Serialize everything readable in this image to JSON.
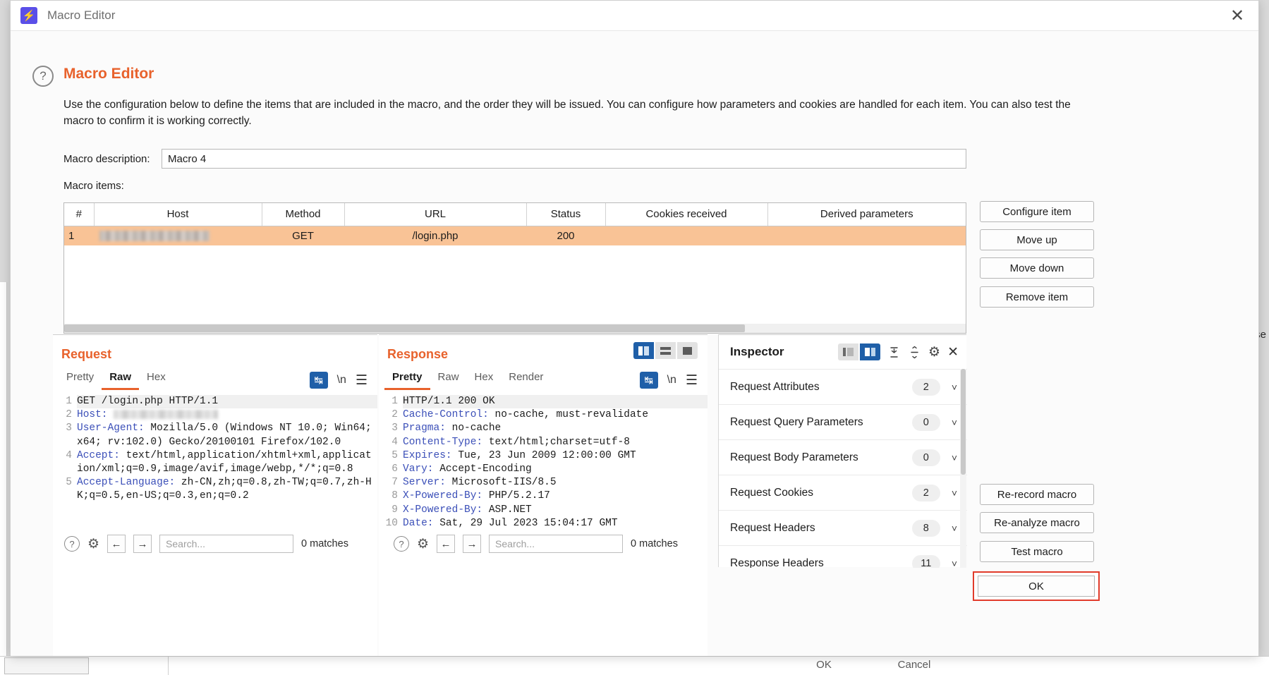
{
  "window": {
    "title": "Macro Editor",
    "app_icon": "lightning-bolt-icon",
    "close_label": "✕"
  },
  "page": {
    "heading": "Macro Editor",
    "help_icon": "?",
    "intro": "Use the configuration below to define the items that are included in the macro, and the order they will be issued. You can configure how parameters and cookies are handled for each item. You can also test the macro to confirm it is working correctly."
  },
  "form": {
    "description_label": "Macro description:",
    "description_value": "Macro 4",
    "items_label": "Macro items:"
  },
  "table": {
    "columns": [
      "#",
      "Host",
      "Method",
      "URL",
      "Status",
      "Cookies received",
      "Derived parameters"
    ],
    "rows": [
      {
        "num": "1",
        "host": "",
        "method": "GET",
        "url": "/login.php",
        "status": "200",
        "cookies": "",
        "derived": ""
      }
    ]
  },
  "side_buttons": {
    "configure_item": "Configure item",
    "move_up": "Move up",
    "move_down": "Move down",
    "remove_item": "Remove item",
    "re_record_macro": "Re-record macro",
    "re_analyze_macro": "Re-analyze macro",
    "test_macro": "Test macro",
    "ok": "OK"
  },
  "request": {
    "title": "Request",
    "tabs": [
      "Pretty",
      "Raw",
      "Hex"
    ],
    "active_tab": "Raw",
    "tools": [
      "wrap-icon",
      "newline-icon",
      "hamburger-icon"
    ],
    "lines": [
      {
        "n": "1",
        "name": "",
        "text": "GET /login.php HTTP/1.1"
      },
      {
        "n": "2",
        "name": "Host:",
        "text": " "
      },
      {
        "n": "3",
        "name": "User-Agent:",
        "text": " Mozilla/5.0 (Windows NT 10.0; Win64; x64; rv:102.0) Gecko/20100101 Firefox/102.0"
      },
      {
        "n": "4",
        "name": "Accept:",
        "text": " text/html,application/xhtml+xml,application/xml;q=0.9,image/avif,image/webp,*/*;q=0.8"
      },
      {
        "n": "5",
        "name": "Accept-Language:",
        "text": " zh-CN,zh;q=0.8,zh-TW;q=0.7,zh-HK;q=0.5,en-US;q=0.3,en;q=0.2"
      }
    ],
    "find": {
      "placeholder": "Search...",
      "matches": "0 matches",
      "help_icon": "?",
      "gear_icon": "gear-icon",
      "prev_icon": "←",
      "next_icon": "→"
    }
  },
  "response": {
    "title": "Response",
    "tabs": [
      "Pretty",
      "Raw",
      "Hex",
      "Render"
    ],
    "active_tab": "Pretty",
    "layout_buttons": [
      "split-vertical-icon",
      "split-horizontal-icon",
      "single-icon"
    ],
    "active_layout": 0,
    "tools": [
      "wrap-icon",
      "newline-icon",
      "hamburger-icon"
    ],
    "lines": [
      {
        "n": "1",
        "name": "",
        "text": "HTTP/1.1 200 OK"
      },
      {
        "n": "2",
        "name": "Cache-Control:",
        "text": " no-cache, must-revalidate"
      },
      {
        "n": "3",
        "name": "Pragma:",
        "text": " no-cache"
      },
      {
        "n": "4",
        "name": "Content-Type:",
        "text": " text/html;charset=utf-8"
      },
      {
        "n": "5",
        "name": "Expires:",
        "text": " Tue, 23 Jun 2009 12:00:00 GMT"
      },
      {
        "n": "6",
        "name": "Vary:",
        "text": " Accept-Encoding"
      },
      {
        "n": "7",
        "name": "Server:",
        "text": " Microsoft-IIS/8.5"
      },
      {
        "n": "8",
        "name": "X-Powered-By:",
        "text": " PHP/5.2.17"
      },
      {
        "n": "9",
        "name": "X-Powered-By:",
        "text": " ASP.NET"
      },
      {
        "n": "10",
        "name": "Date:",
        "text": " Sat, 29 Jul 2023 15:04:17 GMT"
      }
    ],
    "find": {
      "placeholder": "Search...",
      "matches": "0 matches",
      "help_icon": "?",
      "gear_icon": "gear-icon",
      "prev_icon": "←",
      "next_icon": "→"
    }
  },
  "inspector": {
    "title": "Inspector",
    "toggle_left": "dock-left-icon",
    "toggle_right": "dock-right-icon",
    "expand_all_icon": "expand-all-icon",
    "collapse_all_icon": "collapse-all-icon",
    "settings_icon": "gear-icon",
    "close_icon": "✕",
    "rows": [
      {
        "label": "Request Attributes",
        "count": "2"
      },
      {
        "label": "Request Query Parameters",
        "count": "0"
      },
      {
        "label": "Request Body Parameters",
        "count": "0"
      },
      {
        "label": "Request Cookies",
        "count": "2"
      },
      {
        "label": "Request Headers",
        "count": "8"
      },
      {
        "label": "Response Headers",
        "count": "11"
      }
    ]
  },
  "background": {
    "right_text": "se",
    "ok": "OK",
    "cancel": "Cancel"
  },
  "colors": {
    "accent": "#e8622c",
    "selection": "#f9c396",
    "blue": "#1f5fa8",
    "header_blue": "#3b4fb8",
    "highlight_red": "#e13b2b"
  }
}
